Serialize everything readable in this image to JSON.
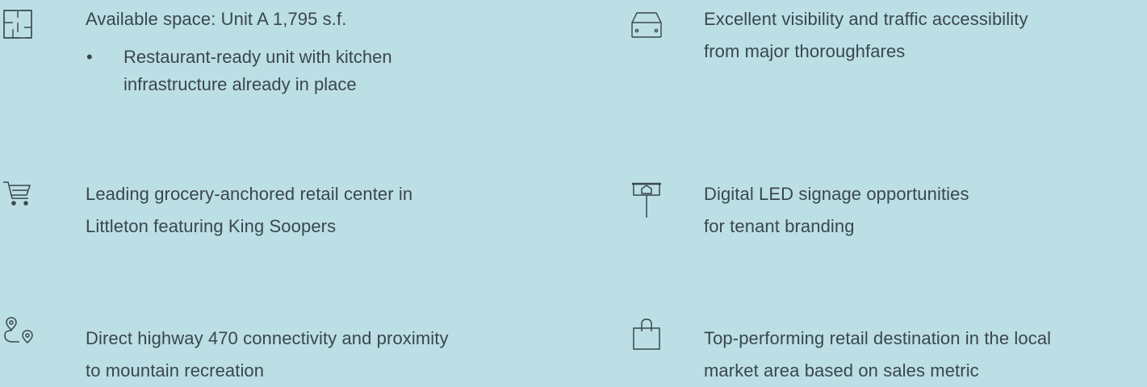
{
  "colors": {
    "background": "#bcdfe6",
    "text": "#3a4650",
    "icon_stroke": "#3a4650"
  },
  "features": [
    {
      "icon": "floor-plan-icon",
      "lines": [
        "Available space: Unit A 1,795 s.f."
      ],
      "bullets": [
        {
          "lines": [
            "Restaurant-ready unit with kitchen",
            "infrastructure already in place"
          ]
        }
      ]
    },
    {
      "icon": "car-icon",
      "lines": [
        "Excellent visibility and traffic accessibility",
        "from major thoroughfares"
      ]
    },
    {
      "icon": "shopping-cart-icon",
      "lines": [
        "Leading grocery-anchored retail center in",
        "Littleton featuring King Soopers"
      ]
    },
    {
      "icon": "signage-icon",
      "lines": [
        "Digital LED signage opportunities",
        "for tenant branding"
      ]
    },
    {
      "icon": "route-icon",
      "lines": [
        "Direct highway 470 connectivity and proximity",
        "to mountain recreation"
      ]
    },
    {
      "icon": "shopping-bag-icon",
      "lines": [
        "Top-performing retail destination in the local",
        "market area based on sales metric"
      ]
    }
  ]
}
